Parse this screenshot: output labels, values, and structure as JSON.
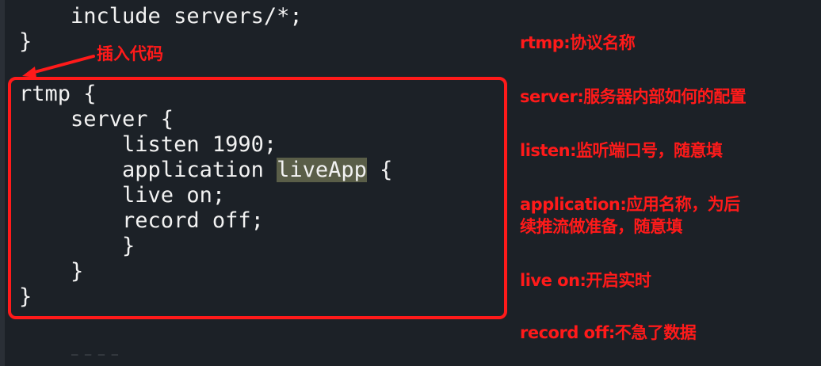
{
  "code": {
    "lines": [
      "    include servers/*;",
      "}",
      "rtmp {",
      "    server {",
      "        listen 1990;",
      "        application ",
      "liveApp",
      " {",
      "        live on;",
      "        record off;",
      "        }",
      "    }",
      "}"
    ]
  },
  "callout": {
    "label": "插入代码"
  },
  "notes": [
    "rtmp:协议名称",
    "server:服务器内部如何的配置",
    "listen:监听端口号，随意填",
    "application:应用名称，为后\n续推流做准备，随意填",
    "live on:开启实时",
    "record off:不急了数据"
  ],
  "colors": {
    "accent": "#ff1a1a",
    "background": "#1c2127",
    "highlight": "#5a5e48"
  }
}
